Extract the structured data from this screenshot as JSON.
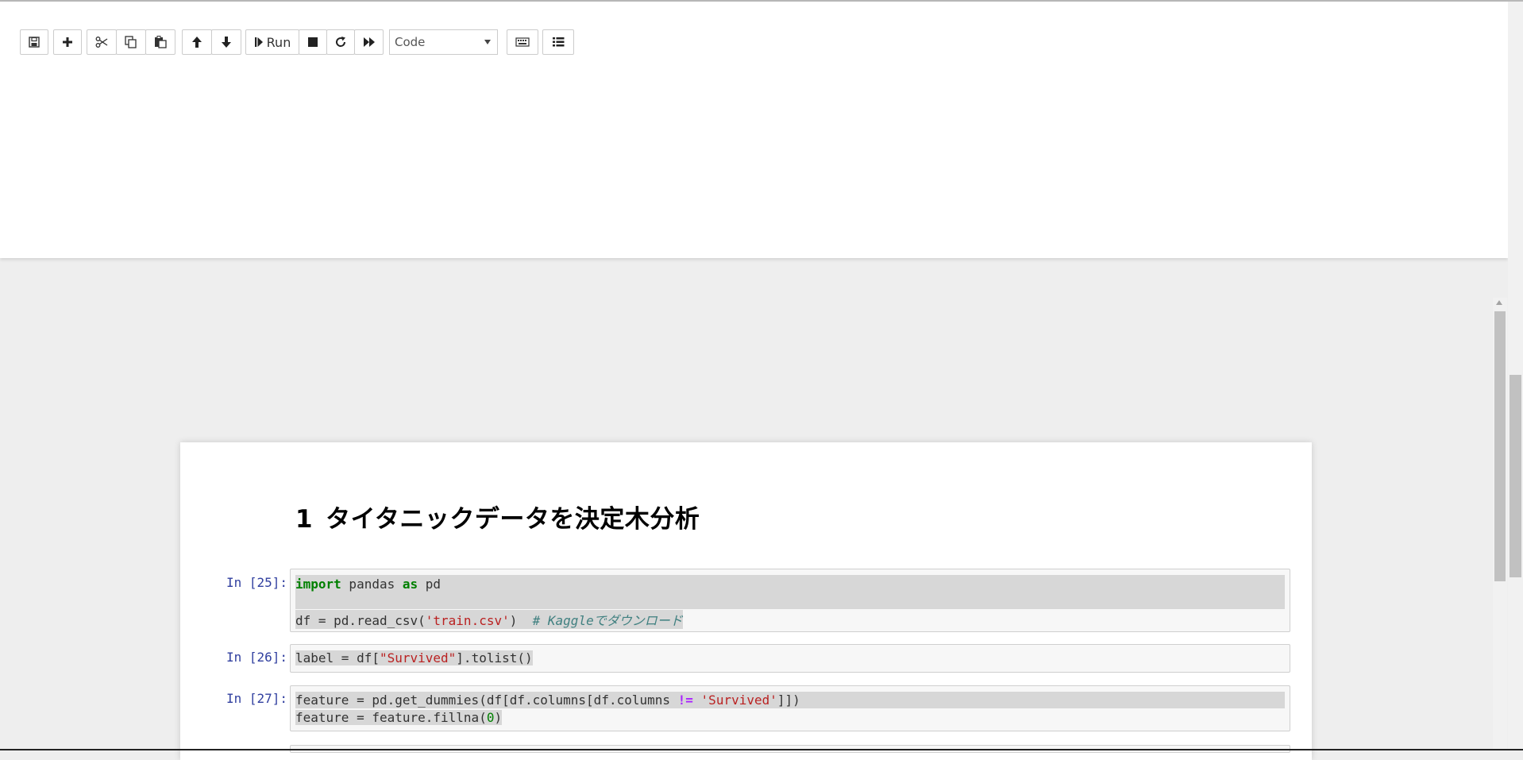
{
  "toolbar": {
    "buttons": [
      {
        "name": "save",
        "icon": "save-icon"
      },
      {
        "name": "insert-cell",
        "icon": "plus-icon"
      },
      {
        "name": "cut",
        "icon": "scissors-icon"
      },
      {
        "name": "copy",
        "icon": "copy-icon"
      },
      {
        "name": "paste",
        "icon": "paste-icon"
      },
      {
        "name": "move-up",
        "icon": "arrow-up-icon"
      },
      {
        "name": "move-down",
        "icon": "arrow-down-icon"
      },
      {
        "name": "run",
        "icon": "step-forward-icon"
      },
      {
        "name": "interrupt",
        "icon": "stop-icon"
      },
      {
        "name": "restart",
        "icon": "refresh-icon"
      },
      {
        "name": "restart-run-all",
        "icon": "fast-forward-icon"
      },
      {
        "name": "command-palette",
        "icon": "keyboard-icon"
      },
      {
        "name": "toc",
        "icon": "list-icon"
      }
    ],
    "run_label": "Run",
    "cell_type": "Code"
  },
  "notebook": {
    "heading_number": "1",
    "heading_text": "タイタニックデータを決定木分析",
    "cells": [
      {
        "prompt": "In [25]:",
        "lines": [
          "import pandas as pd",
          "",
          "df = pd.read_csv('train.csv')  # Kaggleでダウンロード"
        ]
      },
      {
        "prompt": "In [26]:",
        "lines": [
          "label = df[\"Survived\"].tolist()"
        ]
      },
      {
        "prompt": "In [27]:",
        "lines": [
          "feature = pd.get_dummies(df[df.columns[df.columns != 'Survived']])",
          "feature = feature.fillna(0)"
        ]
      }
    ]
  }
}
